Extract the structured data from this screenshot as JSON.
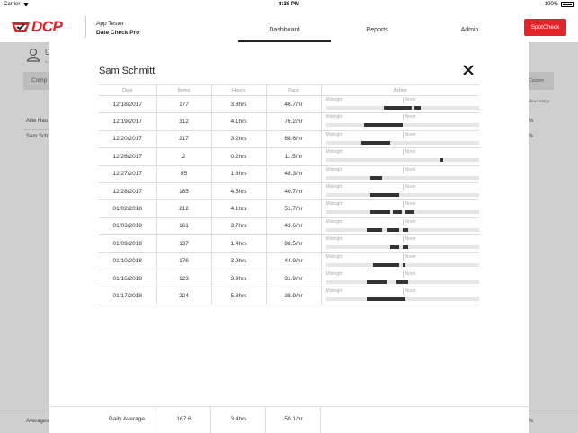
{
  "status_bar": {
    "carrier": "Carrier",
    "time": "8:38 PM",
    "battery": "100%"
  },
  "header": {
    "logo": "DCP",
    "user_name": "App Tester",
    "org_name": "Date Check Pro",
    "nav": [
      "Dashboard",
      "Reports",
      "Admin"
    ],
    "active_tab": "Dashboard",
    "spotcheck_label": "SpotCheck",
    "accent_color": "#e3242b"
  },
  "background": {
    "user_initial": "U",
    "user_sub": "In",
    "column_left": "Comp",
    "column_right": "Custom",
    "column_right_sub": "dlved ntage",
    "rows": [
      {
        "name": "Allie Hau",
        "pct": "%"
      },
      {
        "name": "Sam Sch",
        "pct": "%"
      }
    ],
    "footer_label": "Averages",
    "footer_pct": "%"
  },
  "modal": {
    "title": "Sam Schmitt",
    "columns": {
      "date": "Date",
      "items": "Items",
      "hours": "Hours",
      "pace": "Pace",
      "active": "Active"
    },
    "timeline_labels": {
      "start": "Midnight",
      "mid": "Noon"
    },
    "rows": [
      {
        "date": "12/18/2017",
        "items": "177",
        "hours": "3.8hrs",
        "pace": "46.7/hr",
        "segments": [
          [
            0.38,
            0.56
          ],
          [
            0.58,
            0.62
          ]
        ]
      },
      {
        "date": "12/19/2017",
        "items": "312",
        "hours": "4.1hrs",
        "pace": "76.2/hr",
        "segments": [
          [
            0.25,
            0.5
          ]
        ]
      },
      {
        "date": "12/20/2017",
        "items": "217",
        "hours": "3.2hrs",
        "pace": "68.6/hr",
        "segments": [
          [
            0.23,
            0.42
          ]
        ]
      },
      {
        "date": "12/26/2017",
        "items": "2",
        "hours": "0.2hrs",
        "pace": "11.5/hr",
        "segments": [
          [
            0.75,
            0.77
          ]
        ]
      },
      {
        "date": "12/27/2017",
        "items": "85",
        "hours": "1.8hrs",
        "pace": "48.3/hr",
        "segments": [
          [
            0.29,
            0.37
          ]
        ]
      },
      {
        "date": "12/28/2017",
        "items": "185",
        "hours": "4.5hrs",
        "pace": "40.7/hr",
        "segments": [
          [
            0.29,
            0.48
          ]
        ]
      },
      {
        "date": "01/02/2018",
        "items": "212",
        "hours": "4.1hrs",
        "pace": "51.7/hr",
        "segments": [
          [
            0.29,
            0.42
          ],
          [
            0.44,
            0.5
          ],
          [
            0.52,
            0.58
          ]
        ]
      },
      {
        "date": "01/03/2018",
        "items": "161",
        "hours": "3.7hrs",
        "pace": "43.6/hr",
        "segments": [
          [
            0.27,
            0.37
          ],
          [
            0.4,
            0.48
          ],
          [
            0.5,
            0.54
          ]
        ]
      },
      {
        "date": "01/09/2018",
        "items": "137",
        "hours": "1.4hrs",
        "pace": "98.5/hr",
        "segments": [
          [
            0.42,
            0.48
          ],
          [
            0.5,
            0.54
          ]
        ]
      },
      {
        "date": "01/10/2018",
        "items": "176",
        "hours": "3.9hrs",
        "pace": "44.9/hr",
        "segments": [
          [
            0.31,
            0.48
          ],
          [
            0.5,
            0.52
          ]
        ]
      },
      {
        "date": "01/16/2018",
        "items": "123",
        "hours": "3.9hrs",
        "pace": "31.9/hr",
        "segments": [
          [
            0.27,
            0.4
          ],
          [
            0.46,
            0.54
          ]
        ]
      },
      {
        "date": "01/17/2018",
        "items": "224",
        "hours": "5.8hrs",
        "pace": "38.9/hr",
        "segments": [
          [
            0.27,
            0.52
          ]
        ]
      }
    ],
    "daily_average": {
      "label": "Daily Average",
      "items": "167.6",
      "hours": "3.4hrs",
      "pace": "50.1/hr"
    }
  }
}
